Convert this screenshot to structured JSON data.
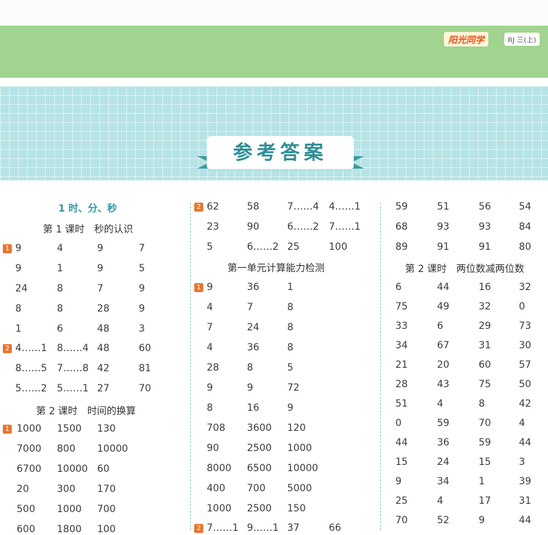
{
  "header": {
    "brand": "阳光同学",
    "tag": "RJ 三(上)",
    "title": "参考答案"
  },
  "col1": {
    "unit": "1  时、分、秒",
    "l1": "第 1 课时　秒的认识",
    "b1": "1",
    "g1": [
      [
        "9",
        "4",
        "9",
        "7"
      ],
      [
        "9",
        "1",
        "9",
        "5"
      ],
      [
        "24",
        "8",
        "7",
        "9"
      ],
      [
        "8",
        "8",
        "28",
        "9"
      ],
      [
        "1",
        "6",
        "48",
        "3"
      ]
    ],
    "b2": "2",
    "g2": [
      [
        "4……1",
        "8……4",
        "48",
        "60"
      ],
      [
        "8……5",
        "7……8",
        "42",
        "81"
      ],
      [
        "5……2",
        "5……1",
        "27",
        "70"
      ]
    ],
    "l2": "第 2 课时　时间的换算",
    "b3": "1",
    "g3": [
      [
        "1000",
        "1500",
        "130"
      ],
      [
        "7000",
        "800",
        "10000"
      ],
      [
        "6700",
        "10000",
        "60"
      ],
      [
        "20",
        "300",
        "170"
      ],
      [
        "500",
        "1000",
        "700"
      ],
      [
        "600",
        "1800",
        "100"
      ]
    ]
  },
  "col2": {
    "b1": "2",
    "g1": [
      [
        "62",
        "58",
        "7……4",
        "4……1"
      ],
      [
        "23",
        "90",
        "6……2",
        "7……1"
      ],
      [
        "5",
        "6……2",
        "25",
        "100"
      ]
    ],
    "t": "第一单元计算能力检测",
    "b2": "1",
    "g2": [
      [
        "9",
        "36",
        "1"
      ],
      [
        "4",
        "7",
        "8"
      ],
      [
        "7",
        "24",
        "8"
      ],
      [
        "4",
        "36",
        "8"
      ],
      [
        "28",
        "8",
        "5"
      ],
      [
        "9",
        "9",
        "72"
      ],
      [
        "8",
        "16",
        "9"
      ],
      [
        "708",
        "3600",
        "120"
      ],
      [
        "90",
        "2500",
        "1000"
      ],
      [
        "8000",
        "6500",
        "10000"
      ],
      [
        "400",
        "700",
        "5000"
      ],
      [
        "1000",
        "2500",
        "150"
      ]
    ],
    "b3": "2",
    "g3": [
      [
        "7……1",
        "9……1",
        "37",
        "66"
      ]
    ]
  },
  "col3": {
    "g1": [
      [
        "59",
        "51",
        "56",
        "54"
      ],
      [
        "68",
        "93",
        "93",
        "84"
      ],
      [
        "89",
        "91",
        "91",
        "80"
      ]
    ],
    "l": "第 2 课时　两位数减两位数",
    "g2": [
      [
        "6",
        "44",
        "16",
        "32"
      ],
      [
        "75",
        "49",
        "32",
        "0"
      ],
      [
        "33",
        "6",
        "29",
        "73"
      ],
      [
        "34",
        "67",
        "31",
        "30"
      ],
      [
        "21",
        "20",
        "60",
        "57"
      ],
      [
        "28",
        "43",
        "75",
        "50"
      ],
      [
        "51",
        "4",
        "8",
        "42"
      ],
      [
        "0",
        "59",
        "70",
        "4"
      ],
      [
        "44",
        "36",
        "59",
        "44"
      ],
      [
        "15",
        "24",
        "15",
        "3"
      ],
      [
        "9",
        "34",
        "1",
        "39"
      ],
      [
        "25",
        "4",
        "17",
        "31"
      ],
      [
        "70",
        "52",
        "9",
        "44"
      ]
    ]
  }
}
